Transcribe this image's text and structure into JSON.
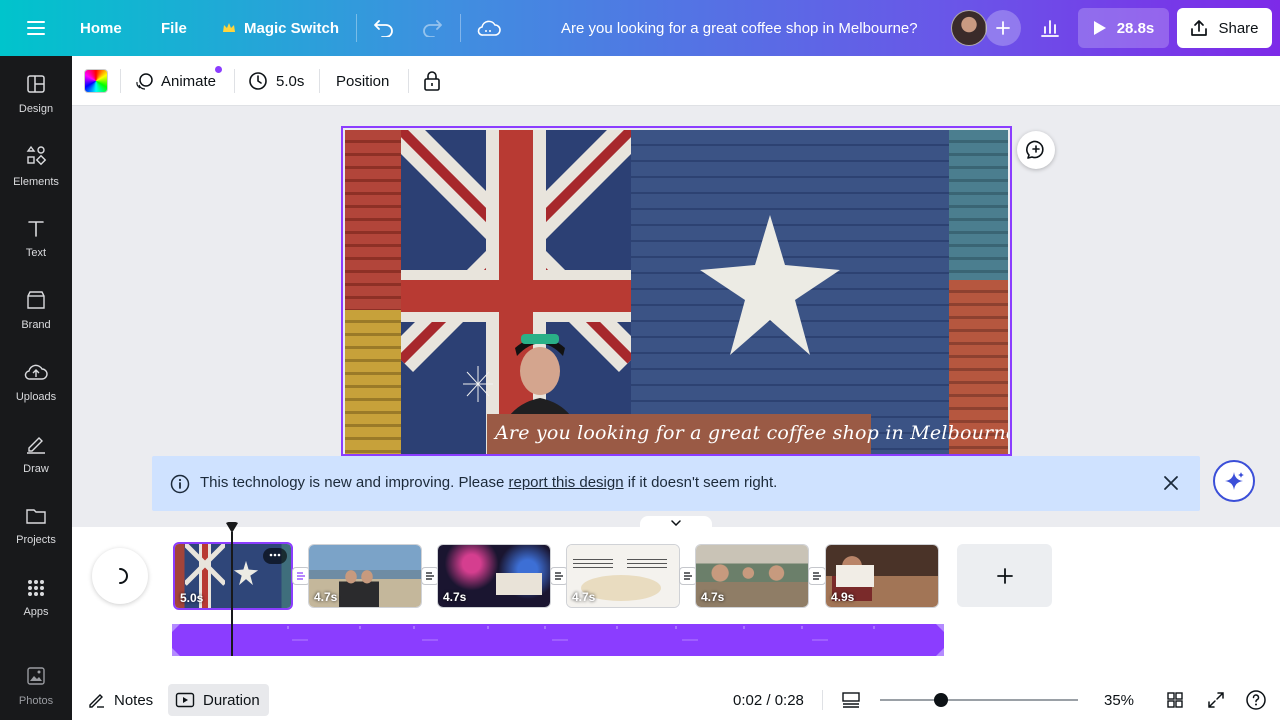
{
  "topbar": {
    "home": "Home",
    "file": "File",
    "magic_switch": "Magic Switch",
    "design_title": "Are you looking for a great coffee shop in Melbourne?",
    "play_duration": "28.8s",
    "share": "Share"
  },
  "sidebar": {
    "items": [
      {
        "label": "Design",
        "icon": "design-icon"
      },
      {
        "label": "Elements",
        "icon": "elements-icon"
      },
      {
        "label": "Text",
        "icon": "text-icon"
      },
      {
        "label": "Brand",
        "icon": "brand-icon"
      },
      {
        "label": "Uploads",
        "icon": "uploads-icon"
      },
      {
        "label": "Draw",
        "icon": "draw-icon"
      },
      {
        "label": "Projects",
        "icon": "projects-icon"
      },
      {
        "label": "Apps",
        "icon": "apps-icon"
      },
      {
        "label": "Photos",
        "icon": "photos-icon"
      }
    ]
  },
  "toolbar": {
    "animate": "Animate",
    "duration": "5.0s",
    "position": "Position"
  },
  "canvas": {
    "caption": "Are you looking for a great coffee shop in Melbourne?"
  },
  "banner": {
    "text_before": "This technology is new and improving. Please ",
    "link": "report this design",
    "text_after": " if it doesn't seem right."
  },
  "timeline": {
    "clips": [
      {
        "duration": "5.0s",
        "selected": true
      },
      {
        "duration": "4.7s",
        "selected": false
      },
      {
        "duration": "4.7s",
        "selected": false
      },
      {
        "duration": "4.7s",
        "selected": false
      },
      {
        "duration": "4.7s",
        "selected": false
      },
      {
        "duration": "4.9s",
        "selected": false
      }
    ]
  },
  "bottombar": {
    "notes": "Notes",
    "duration": "Duration",
    "time": "0:02 / 0:28",
    "zoom": "35%"
  },
  "colors": {
    "accent": "#8b3dff",
    "banner_bg": "#cfe2ff",
    "sidebar_bg": "#18191b"
  }
}
